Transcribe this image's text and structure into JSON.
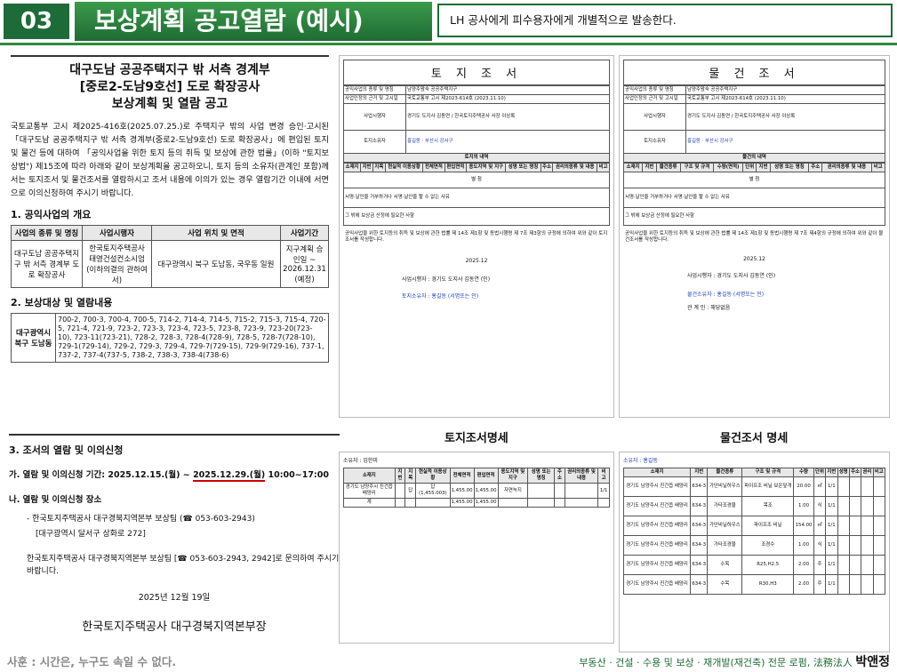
{
  "header": {
    "number": "03",
    "title": "보상계획 공고열람 (예시)",
    "desc": "LH 공사에게 피수용자에게 개별적으로 발송한다."
  },
  "announcement": {
    "title1": "대구도남 공공주택지구 밖 서측 경계부",
    "title2": "[중로2-도남9호선] 도로 확장공사",
    "title3": "보상계획 및 열람 공고",
    "body": "국토교통부 고시 제2025-416호(2025.07.25.)로 주택지구 밖의 사업 변경 승인·고시된 「대구도남 공공주택지구 밖 서측 경계부(중로2-도남9호선) 도로 확장공사」에 편입된 토지 및 물건 등에 대하여 「공익사업을 위한 토지 등의 취득 및 보상에 관한 법률」(이하 \"토지보상법\") 제15조에 따라 아래와 같이 보상계획을 공고하오니, 토지 등의 소유자(관계인 포함)께서는 토지조서 및 물건조서를 열람하시고 조서 내용에 이의가 있는 경우 열람기간 이내에 서면으로 이의신청하여 주시기 바랍니다.",
    "s1": "1. 공익사업의 개요",
    "t1h": [
      "사업의 종류 및 명칭",
      "사업시행자",
      "사업 위치 및 면적",
      "사업기간"
    ],
    "t1r": [
      "대구도남 공공주택지구 밖 서측 경계부 도로 확장공사",
      "한국토지주택공사 태영건설컨소시엄 (이하의결의 관하여서)",
      "대구광역시 북구 도남동, 국우동 일원",
      "지구계획 승인일 ~ 2026.12.31 (예정)"
    ],
    "s2": "2. 보상대상 및 열람내용",
    "t2l": "대구광역시 북구 도남동",
    "t2r": "700-2, 700-3, 700-4, 700-5, 714-2, 714-4, 714-5, 715-2, 715-3, 715-4, 720-5, 721-4, 721-9, 723-2, 723-3, 723-4, 723-5, 723-8, 723-9, 723-20(723-10), 723-11(723-21), 728-2, 728-3, 728-4(728-9), 728-5, 728-7(728-10), 729-1(729-14), 729-2, 729-3, 729-4, 729-7(729-15), 729-9(729-16), 737-1, 737-2, 737-4(737-5, 738-2, 738-3, 738-4(738-6)"
  },
  "notice": {
    "s3": "3. 조서의 열람 및 이의신청",
    "ga": "가. 열람 및 이의신청 기간: 2025.12.15.(월) ~ ",
    "gadate": "2025.12.29.(월)",
    "gatime": " 10:00~17:00",
    "na": "나. 열람 및 이의신청 장소",
    "place1": "- 한국토지주택공사 대구경북지역본부 보상팀 (☎ 053-603-2943)",
    "place2": "[대구광역시 달서구 상화로 272]",
    "contact": "한국토지주택공사 대구경북지역본부 보상팀 [☎ 053-603-2943, 2942]로 문의하여 주시기 바랍니다.",
    "date": "2025년 12월 19일",
    "sign": "한국토지주택공사 대구경북지역본부장"
  },
  "doc1": {
    "title": "토 지 조 서",
    "r1": "공익사업의 종류 및 명칭",
    "v1": "남양주왕숙 공공주택지구",
    "r2": "사업인정의 근거 및 고시일",
    "v2": "국토교통부 고시 제2023-614호 (2023.11.10)",
    "r3": "사업시행자",
    "v3": "경기도 도지사 김동연 / 한국토지주택공사 사장 이상록",
    "r4": "토지소유자",
    "v4a": "홍길동",
    "v4b": "부산시 강서구",
    "sub": "토지의 내역",
    "cols": [
      "소재지",
      "지번",
      "지목",
      "현실적 이용상황",
      "전체면적",
      "편입면적",
      "용도지역 및 지구",
      "성명 또는 명칭",
      "주소",
      "권리의종류 및 내용",
      "비고"
    ],
    "note": "별 첨",
    "reason": "서명·날인을 거부하거나 서명·날인을 할 수 없는 사유",
    "other": "그 밖에 보상금 산정에 필요한 사항",
    "law": "공익사업을 위한 토지등의 취득 및 보상에 관한 법률 제 14조 제1항 및 동법시행령 제 7조 제3항의 규정에 의하여 위와 같이 토지조서를 작성합니다.",
    "date": "2025.12",
    "signer": "사업시행자 : 경기도 도지사 김동연 (인)",
    "owner": "토지소유자 : 홍길동 (서명또는 인)"
  },
  "doc2": {
    "title": "물 건 조 서",
    "sub": "물건의 내역",
    "cols": [
      "소재지",
      "지번",
      "물건종류",
      "구조 및 규격",
      "수량(면적)",
      "단위",
      "지번",
      "성명 또는 명칭",
      "주소",
      "권리의종류 및 내용",
      "비고"
    ],
    "law": "공익사업을 위한 토지등의 취득 및 보상에 관한 법률 제 14조 제1항 및 동법시행령 제 7조 제4항의 규정에 의하여 위와 같이 물건조서를 작성합니다.",
    "date": "2025.12",
    "signer": "사업시행자 : 경기도 도지사 김동연 (인)",
    "owner": "물건소유자 : 홍길동 (서명또는 인)",
    "rel": "관 계 인 : 해당없음"
  },
  "low1": {
    "title": "토지조서명세",
    "owner": "소유자 : 임한미",
    "cols": [
      "소재지",
      "지번",
      "지목",
      "현실적 이용상황",
      "전체면적",
      "편입면적",
      "용도지역 및 지구",
      "성명 또는 명칭",
      "주소",
      "권리의종류 및 내용",
      "비고"
    ],
    "row": [
      "경기도 남양주시 진건읍 배양리",
      "",
      "답",
      "답(1,455.003)",
      "1,455.00",
      "1,455.00",
      "자연녹지",
      "",
      "",
      "",
      "1/1"
    ],
    "total": [
      "계",
      "",
      "",
      "",
      "1,455.00",
      "1,455.00",
      "",
      "",
      "",
      "",
      ""
    ]
  },
  "low2": {
    "title": "물건조서 명세",
    "owner": "소유자 : 홍길동",
    "cols": [
      "소재지",
      "지번",
      "물건종류",
      "구조 및 규격",
      "수량",
      "단위",
      "지번",
      "성명",
      "주소",
      "권리",
      "비고"
    ],
    "rows": [
      [
        "경기도 남양주시 진건읍 배양리",
        "634-3",
        "가단비닐하우스",
        "파이프조 비닐 보온덮개",
        "20.00",
        "㎡",
        "1/1"
      ],
      [
        "경기도 남양주시 진건읍 배양리",
        "634-3",
        "가타조경물",
        "목조",
        "1.00",
        "식",
        "1/1"
      ],
      [
        "경기도 남양주시 진건읍 배양리",
        "634-3",
        "가단비닐하우스",
        "파이프조 비닐",
        "154.00",
        "㎡",
        "1/1"
      ],
      [
        "경기도 남양주시 진건읍 배양리",
        "634-3",
        "가타조경물",
        "조경수",
        "1.00",
        "식",
        "1/1"
      ],
      [
        "경기도 남양주시 진건읍 배양리",
        "634-3",
        "수목",
        "R25,H2.5",
        "2.00",
        "주",
        "1/1"
      ],
      [
        "경기도 남양주시 진건읍 배양리",
        "634-3",
        "수목",
        "R30,H3",
        "2.00",
        "주",
        "1/1"
      ]
    ]
  },
  "footer": {
    "left": "사훈 : 시간은, 누구도 속일 수 없다.",
    "right": "부동산 · 건설 · 수용 및 보상 · 재개발(재건축) 전문 로펌, 法務法人",
    "brand": "박앤정"
  }
}
